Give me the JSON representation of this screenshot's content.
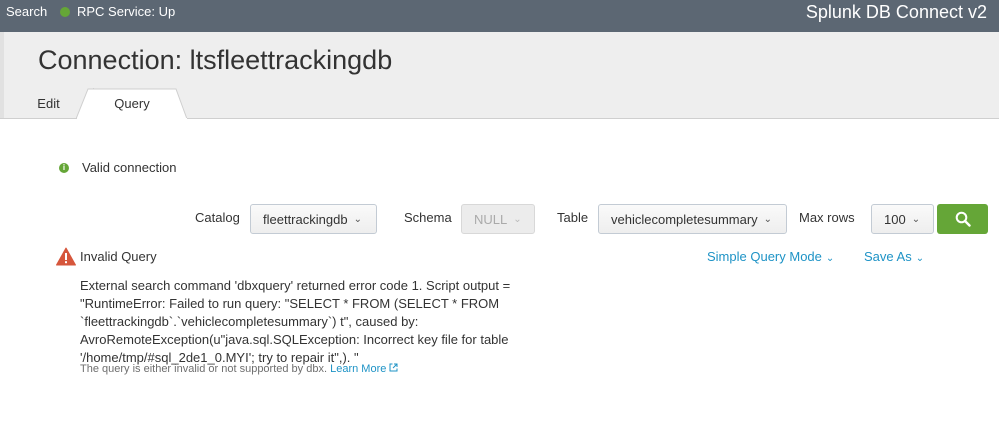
{
  "topbar": {
    "search_label": "Search",
    "rpc_status": "RPC Service: Up",
    "app_name": "Splunk DB Connect v2"
  },
  "header": {
    "title": "Connection: ltsfleettrackingdb"
  },
  "tabs": [
    {
      "label": "Edit",
      "active": false
    },
    {
      "label": "Query",
      "active": true
    }
  ],
  "status": {
    "valid_text": "Valid connection"
  },
  "toolbar": {
    "catalog_label": "Catalog",
    "catalog_value": "fleettrackingdb",
    "schema_label": "Schema",
    "schema_value": "NULL",
    "table_label": "Table",
    "table_value": "vehiclecompletesummary",
    "maxrows_label": "Max rows",
    "maxrows_value": "100",
    "search_button_icon": "search-icon"
  },
  "error": {
    "title": "Invalid Query",
    "simple_query_mode": "Simple Query Mode",
    "save_as": "Save As",
    "lines": [
      "External search command 'dbxquery' returned error code 1. Script output =",
      "\"RuntimeError: Failed to run query: \"SELECT * FROM (SELECT * FROM",
      "`fleettrackingdb`.`vehiclecompletesummary`) t\", caused by:",
      "AvroRemoteException(u\"java.sql.SQLException: Incorrect key file for table",
      "'/home/tmp/#sql_2de1_0.MYI'; try to repair it\",). \""
    ],
    "hint": "The query is either invalid or not supported by dbx.",
    "learn_more": "Learn More"
  },
  "colors": {
    "topbar": "#5c6773",
    "success": "#65a637",
    "warning": "#d6563c",
    "link": "#1e93c6"
  }
}
